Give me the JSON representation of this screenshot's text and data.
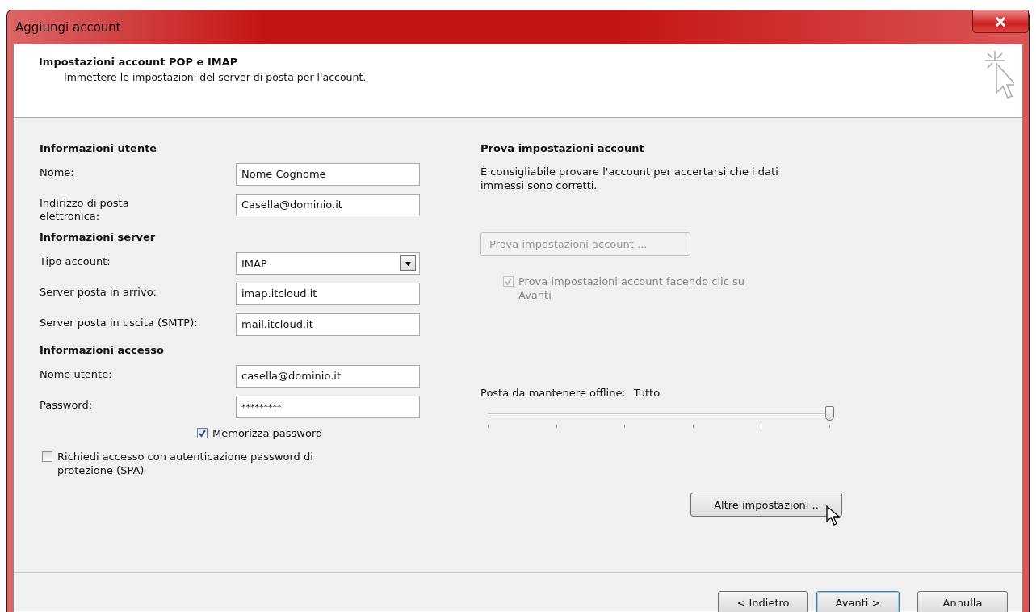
{
  "window": {
    "title": "Aggiungi account"
  },
  "header": {
    "title": "Impostazioni account POP e IMAP",
    "subtitle": "Immettere le impostazioni del server di posta per l'account."
  },
  "sections": [
    {
      "heading": "Informazioni utente",
      "fields": [
        {
          "kind": "text",
          "label": "Nome:",
          "value": "Nome Cognome"
        },
        {
          "kind": "text",
          "label": "Indirizzo di posta elettronica:",
          "value": "Casella@dominio.it"
        }
      ]
    },
    {
      "heading": "Informazioni server",
      "fields": [
        {
          "kind": "dropdown",
          "label": "Tipo account:",
          "value": "IMAP"
        },
        {
          "kind": "text",
          "label": "Server posta in arrivo:",
          "value": "imap.itcloud.it"
        },
        {
          "kind": "text",
          "label": "Server posta in uscita (SMTP):",
          "value": "mail.itcloud.it"
        }
      ]
    },
    {
      "heading": "Informazioni accesso",
      "fields": [
        {
          "kind": "text",
          "label": "Nome utente:",
          "value": "casella@dominio.it"
        },
        {
          "kind": "password",
          "label": "Password:",
          "value": "*********"
        }
      ]
    }
  ],
  "options": [
    {
      "kind": "indented",
      "label": "Memorizza password",
      "checked": true
    },
    {
      "kind": "plain",
      "label": "Richiedi accesso con autenticazione password di protezione (SPA)",
      "checked": false
    }
  ],
  "test": {
    "heading": "Prova impostazioni account",
    "description": "È consigliabile provare l'account per accertarsi che i dati immessi sono corretti.",
    "button": {
      "label": "Prova impostazioni account ...",
      "disabled": true
    },
    "checkbox": {
      "label": "Prova impostazioni account facendo clic su Avanti",
      "checked": true,
      "disabled": true
    }
  },
  "offline": {
    "label": "Posta da mantenere offline:",
    "value": "Tutto",
    "level": 1
  },
  "more_button": {
    "label": "Altre impostazioni .."
  },
  "buttons": [
    {
      "label": "< Indietro",
      "default": false
    },
    {
      "label": "Avanti >",
      "default": true
    },
    {
      "label": "Annulla",
      "default": false
    }
  ]
}
